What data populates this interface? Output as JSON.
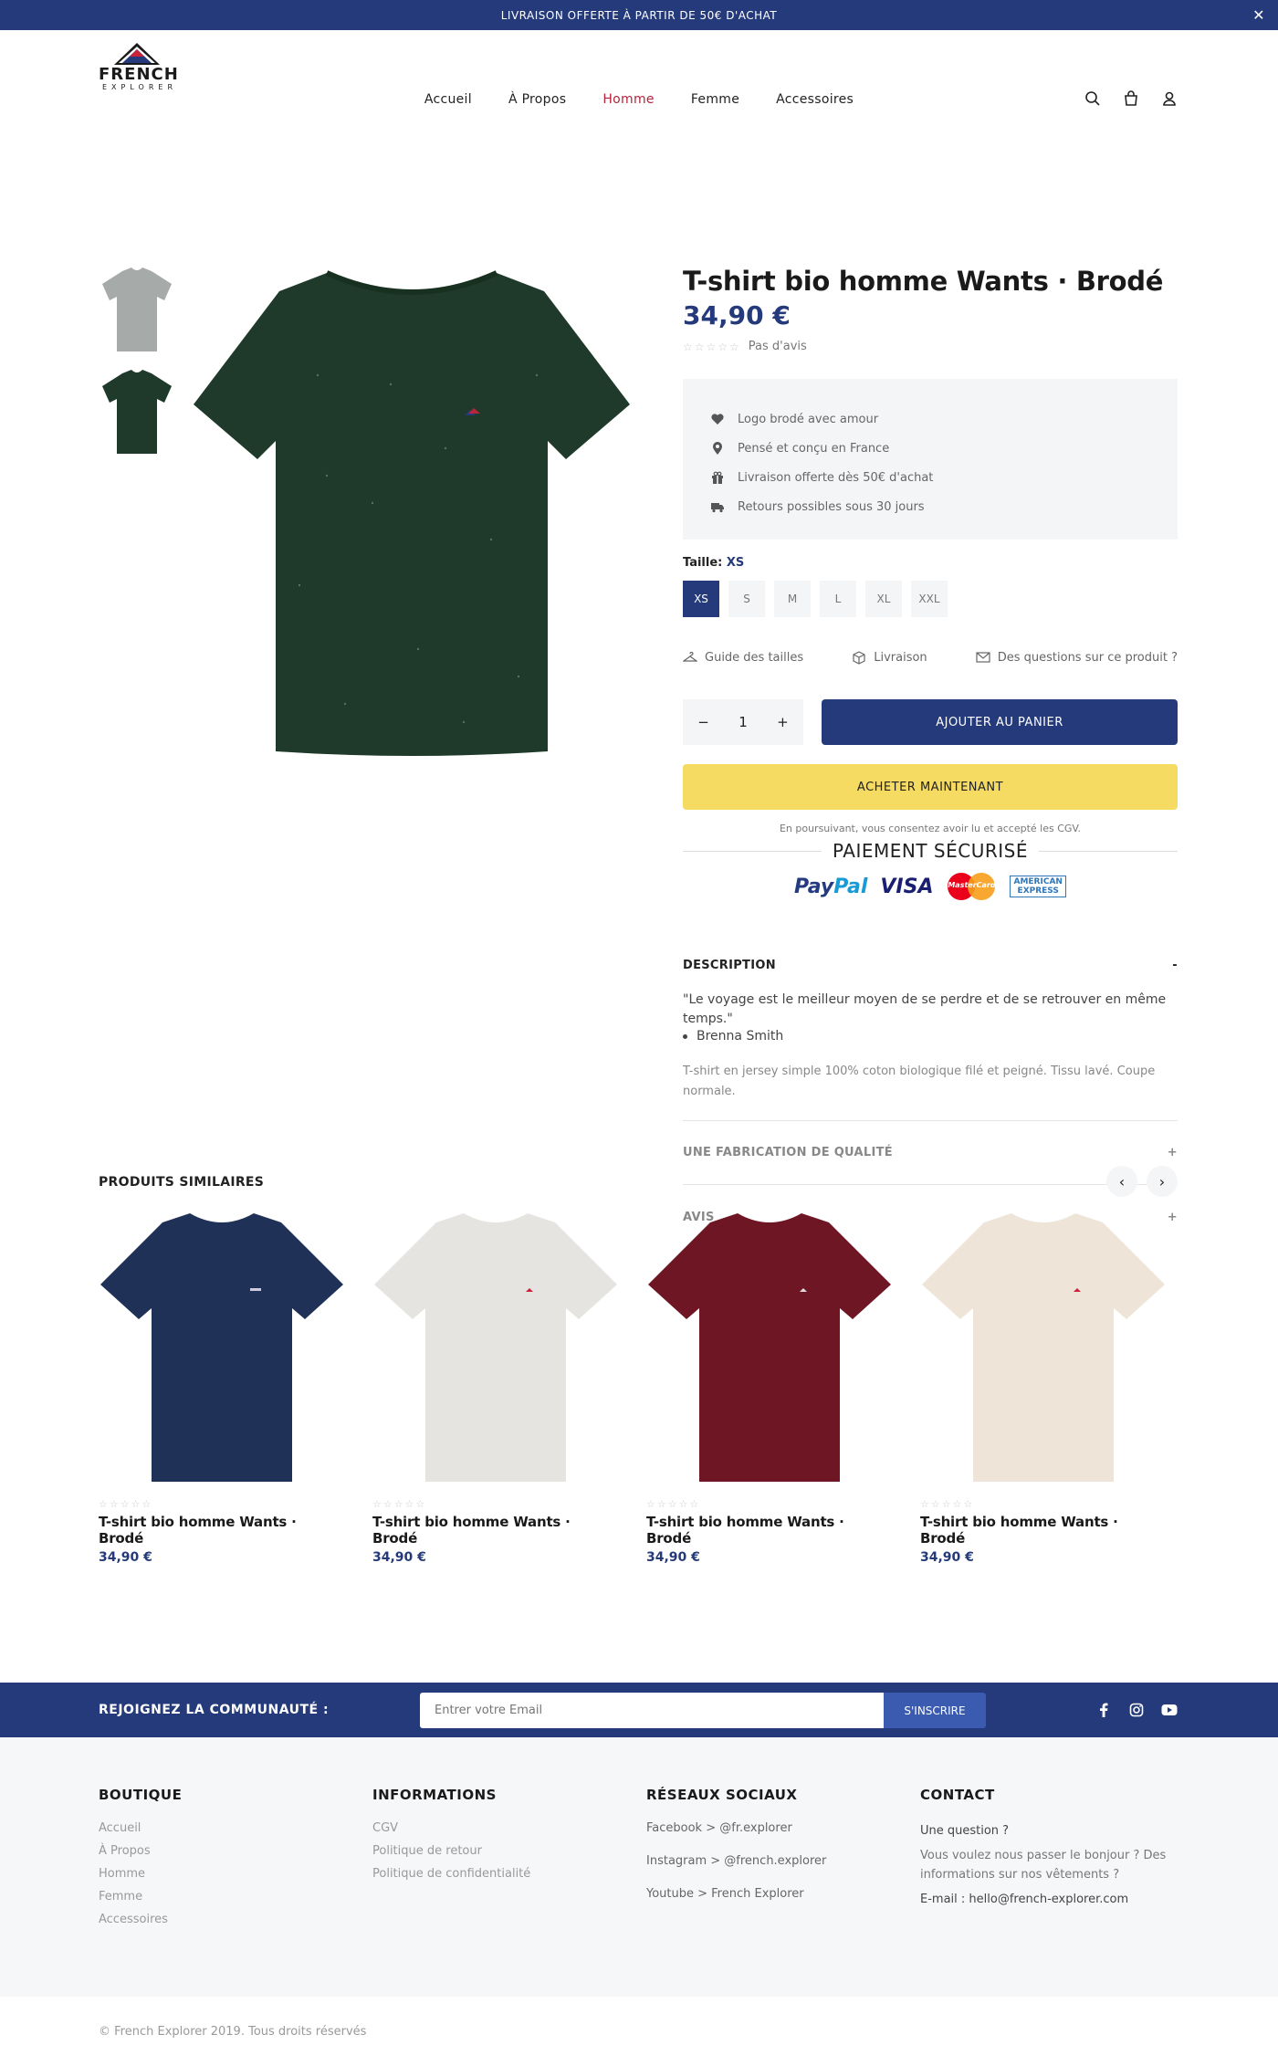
{
  "topbar": {
    "text": "LIVRAISON OFFERTE À PARTIR DE 50€ D'ACHAT",
    "close": "✕"
  },
  "logo": {
    "line1": "FRENCH",
    "line2": "EXPLORER"
  },
  "nav": [
    {
      "label": "Accueil"
    },
    {
      "label": "À Propos"
    },
    {
      "label": "Homme",
      "active": true
    },
    {
      "label": "Femme"
    },
    {
      "label": "Accessoires"
    }
  ],
  "product": {
    "title": "T-shirt bio homme Wants · Brodé",
    "price": "34,90 €",
    "rating_text": "Pas d'avis",
    "stars": "☆☆☆☆☆",
    "features": [
      {
        "icon": "heart-icon",
        "text": "Logo brodé avec amour"
      },
      {
        "icon": "map-pin-icon",
        "text": "Pensé et conçu en France"
      },
      {
        "icon": "gift-icon",
        "text": "Livraison offerte dès 50€ d'achat"
      },
      {
        "icon": "truck-icon",
        "text": "Retours possibles sous 30 jours"
      }
    ],
    "size_label": "Taille:",
    "size_selected": "XS",
    "sizes": [
      "XS",
      "S",
      "M",
      "L",
      "XL",
      "XXL"
    ],
    "links": {
      "guide": "Guide des tailles",
      "delivery": "Livraison",
      "questions": "Des questions sur ce produit ?"
    },
    "quantity": "1",
    "qty_minus": "−",
    "qty_plus": "+",
    "add_to_cart": "AJOUTER AU PANIER",
    "buy_now": "ACHETER MAINTENANT",
    "cgv": "En poursuivant, vous consentez avoir lu et accepté les CGV.",
    "secure_payment": "PAIEMENT SÉCURISÉ",
    "pay": {
      "paypal1": "Pay",
      "paypal2": "Pal",
      "visa": "VISA",
      "mastercard": "MasterCard",
      "amex1": "AMERICAN",
      "amex2": "EXPRESS"
    },
    "description": {
      "title": "DESCRIPTION",
      "toggle": "-",
      "quote": "\"Le voyage est le meilleur moyen de se perdre et de se retrouver en même temps.\"",
      "author": "Brenna Smith",
      "text": "T-shirt en jersey simple 100% coton biologique filé et peigné. Tissu lavé. Coupe normale."
    },
    "accordions": [
      {
        "title": "UNE FABRICATION DE QUALITÉ",
        "toggle": "+"
      },
      {
        "title": "AVIS",
        "toggle": "+"
      }
    ],
    "colors": {
      "main_shirt": "#1f3a2b",
      "thumb1": "#a6aaa8",
      "thumb2": "#1f3a2b"
    }
  },
  "similar": {
    "title": "PRODUITS SIMILAIRES",
    "prev": "‹",
    "next": "›",
    "items": [
      {
        "name": "T-shirt bio homme Wants · Brodé",
        "price": "34,90 €",
        "stars": "☆☆☆☆☆",
        "color": "#1f3157"
      },
      {
        "name": "T-shirt bio homme Wants · Brodé",
        "price": "34,90 €",
        "stars": "☆☆☆☆☆",
        "color": "#e6e4e0"
      },
      {
        "name": "T-shirt bio homme Wants · Brodé",
        "price": "34,90 €",
        "stars": "☆☆☆☆☆",
        "color": "#6e1624"
      },
      {
        "name": "T-shirt bio homme Wants · Brodé",
        "price": "34,90 €",
        "stars": "☆☆☆☆☆",
        "color": "#efe4d8"
      }
    ]
  },
  "newsletter": {
    "title": "REJOIGNEZ LA COMMUNAUTÉ :",
    "placeholder": "Entrer votre Email",
    "button": "S'INSCRIRE"
  },
  "footer": {
    "boutique": {
      "title": "BOUTIQUE",
      "links": [
        "Accueil",
        "À Propos",
        "Homme",
        "Femme",
        "Accessoires"
      ]
    },
    "informations": {
      "title": "INFORMATIONS",
      "links": [
        "CGV",
        "Politique de retour",
        "Politique de confidentialité"
      ]
    },
    "reseaux": {
      "title": "RÉSEAUX SOCIAUX",
      "links": [
        "Facebook > @fr.explorer",
        "Instagram > @french.explorer",
        "Youtube > French Explorer"
      ]
    },
    "contact": {
      "title": "CONTACT",
      "question": "Une question ?",
      "hello": "Vous voulez nous passer le bonjour ? Des informations sur nos vêtements ?",
      "email": "E-mail : hello@french-explorer.com"
    },
    "copyright": "© French Explorer 2019. Tous droits réservés"
  }
}
